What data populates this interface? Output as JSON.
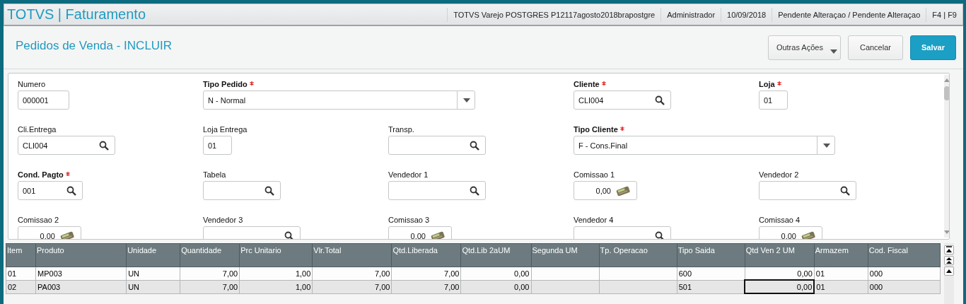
{
  "header": {
    "title": "TOTVS | Faturamento",
    "info": [
      "TOTVS Varejo POSTGRES P12117agosto2018brapostgre",
      "Administrador",
      "10/09/2018",
      "Pendente Alteraçao / Pendente Alteraçao",
      "F4 | F9"
    ]
  },
  "page": {
    "title": "Pedidos de Venda - INCLUIR",
    "buttons": [
      {
        "label": "Outras Ações",
        "kind": "menu"
      },
      {
        "label": "Cancelar",
        "kind": "plain"
      },
      {
        "label": "Salvar",
        "kind": "primary"
      }
    ]
  },
  "form": {
    "rows": [
      [
        {
          "label": "Numero",
          "value": "000001",
          "required": false,
          "kind": "text"
        },
        {
          "label": "Tipo Pedido",
          "value": "N - Normal",
          "required": true,
          "kind": "select"
        },
        "",
        {
          "label": "Cliente",
          "value": "CLI004",
          "required": true,
          "kind": "lookup"
        },
        {
          "label": "Loja",
          "value": "01",
          "required": true,
          "kind": "text"
        }
      ],
      [
        {
          "label": "Cli.Entrega",
          "value": "CLI004",
          "required": false,
          "kind": "lookup"
        },
        {
          "label": "Loja Entrega",
          "value": "01",
          "required": false,
          "kind": "text"
        },
        {
          "label": "Transp.",
          "required": false,
          "kind": "lookup"
        },
        {
          "label": "Tipo Cliente",
          "value": "F - Cons.Final",
          "required": true,
          "kind": "select"
        },
        ""
      ],
      [
        {
          "label": "Cond. Pagto",
          "value": "001",
          "required": true,
          "kind": "lookup"
        },
        {
          "label": "Tabela",
          "required": false,
          "kind": "lookup"
        },
        {
          "label": "Vendedor 1",
          "required": false,
          "kind": "lookup"
        },
        {
          "label": "Comissao 1",
          "value": "0,00",
          "required": false,
          "kind": "money"
        },
        {
          "label": "Vendedor 2",
          "required": false,
          "kind": "lookup"
        }
      ],
      [
        {
          "label": "Comissao 2",
          "value": "0,00",
          "required": false,
          "kind": "money"
        },
        {
          "label": "Vendedor 3",
          "required": false,
          "kind": "lookup"
        },
        {
          "label": "Comissao 3",
          "value": "0,00",
          "required": false,
          "kind": "money"
        },
        {
          "label": "Vendedor 4",
          "required": false,
          "kind": "lookup"
        },
        {
          "label": "Comissao 4",
          "value": "0,00",
          "required": false,
          "kind": "money"
        }
      ]
    ]
  },
  "table": {
    "columns": [
      {
        "label": "Item",
        "numeric": false
      },
      {
        "label": "Produto",
        "numeric": false
      },
      {
        "label": "Unidade",
        "numeric": false
      },
      {
        "label": "Quantidade",
        "numeric": true
      },
      {
        "label": "Prc Unitario",
        "numeric": true
      },
      {
        "label": "Vlr.Total",
        "numeric": true
      },
      {
        "label": "Qtd.Liberada",
        "numeric": true
      },
      {
        "label": "Qtd.Lib 2aUM",
        "numeric": true
      },
      {
        "label": "Segunda UM"
      },
      {
        "label": "Tp. Operacao"
      },
      {
        "label": "Tipo Saida",
        "numeric": false
      },
      {
        "label": "Qtd Ven 2 UM",
        "numeric": true
      },
      {
        "label": "Armazem",
        "numeric": false
      },
      {
        "label": "Cod. Fiscal",
        "numeric": false
      }
    ],
    "rows": [
      {
        "selected": false,
        "cells": [
          {
            "text": "01",
            "focused": false
          },
          {
            "text": "MP003",
            "focused": false
          },
          {
            "text": "UN",
            "focused": false
          },
          {
            "text": "7,00",
            "focused": false
          },
          {
            "text": "1,00",
            "focused": false
          },
          {
            "text": "7,00",
            "focused": false
          },
          {
            "text": "7,00",
            "focused": false
          },
          {
            "text": "0,00",
            "focused": false
          },
          {
            "focused": false
          },
          {
            "focused": false
          },
          {
            "text": "600",
            "focused": false
          },
          {
            "text": "0,00",
            "focused": false
          },
          {
            "text": "01",
            "focused": false
          },
          {
            "text": "000",
            "focused": false
          }
        ]
      },
      {
        "selected": true,
        "cells": [
          {
            "text": "02",
            "focused": false
          },
          {
            "text": "PA003",
            "focused": false
          },
          {
            "text": "UN",
            "focused": false
          },
          {
            "text": "7,00",
            "focused": false
          },
          {
            "text": "1,00",
            "focused": false
          },
          {
            "text": "7,00",
            "focused": false
          },
          {
            "text": "7,00",
            "focused": false
          },
          {
            "text": "0,00",
            "focused": false
          },
          {
            "focused": false
          },
          {
            "focused": false
          },
          {
            "text": "501",
            "focused": false
          },
          {
            "text": "0,00",
            "focused": true
          },
          {
            "text": "01",
            "focused": false
          },
          {
            "text": "000",
            "focused": false
          }
        ]
      }
    ]
  }
}
